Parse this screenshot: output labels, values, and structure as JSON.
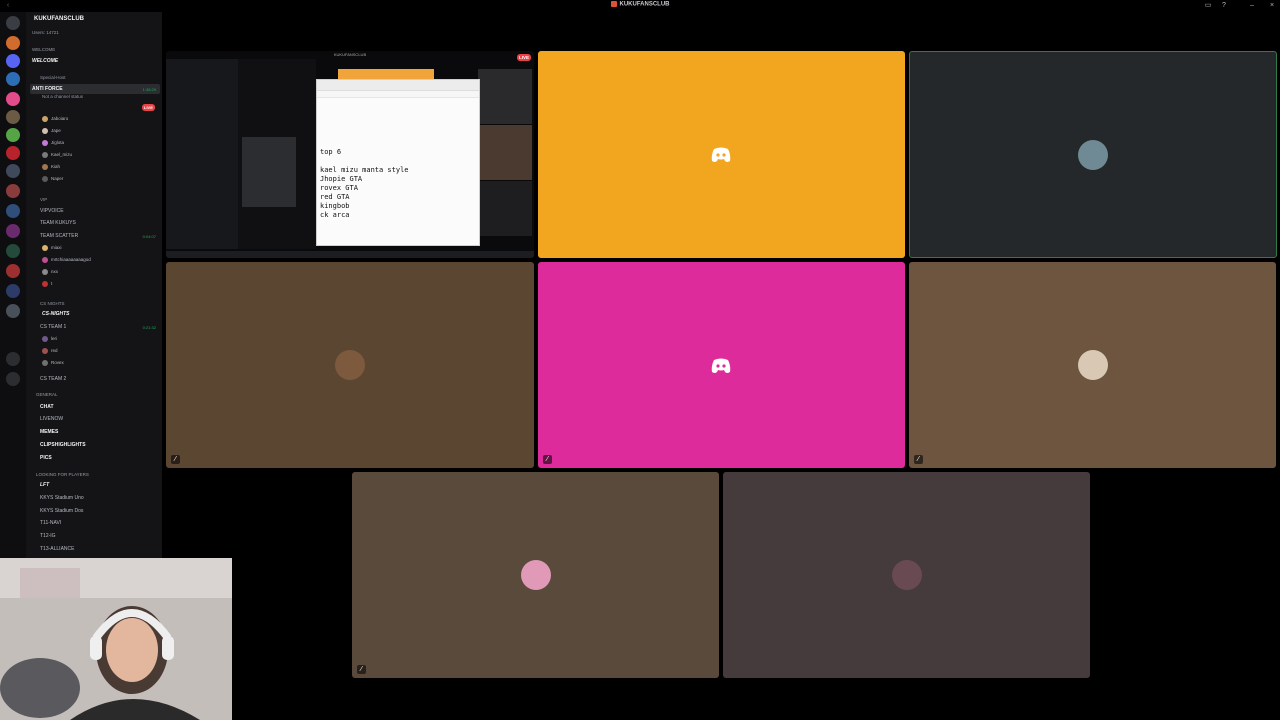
{
  "window": {
    "title": "KUKUFANSCLUB"
  },
  "server": {
    "name": "KUKUFANSCLUB",
    "users": "Users: 14721"
  },
  "channels": {
    "welcome_cat": "WELCOME",
    "welcome": "WELCOME",
    "special_cat": "Special-Host",
    "anti_force": "ANTI FORCE",
    "anti_force_status": "Not a channel status",
    "anti_force_timer": "1:38:29",
    "live": "LIVE",
    "voice_users_1": [
      "Jaboiaro",
      "Jape",
      "Jiglota",
      "Kael_mizu",
      "Kiah",
      "Naper"
    ],
    "vip_cat": "VIP",
    "vipvoice": "VIPVOICE",
    "team_kukuys": "TEAM KUKUYS",
    "team_scatter": "TEAM SCATTER",
    "team_scatter_timer": "0:04:07",
    "voice_users_2": [
      "miaxi",
      "mrtchiaaaaaaaagod",
      "nxx",
      "t"
    ],
    "cs_cat": "CS NIGHTS",
    "cs_nights": "CS-NIGHTS",
    "cs_team1": "CS TEAM 1",
    "cs_team1_timer": "0:21:32",
    "voice_users_3": [
      "leri",
      "red",
      "Rovex"
    ],
    "cs_team2": "CS TEAM 2",
    "general_cat": "GENERAL",
    "chat": "CHAT",
    "livenow": "LIVENOW",
    "memes": "MEMES",
    "clips": "CLIPSHIGHLIGHTS",
    "pics": "PICS",
    "lfp_cat": "LOOKING FOR PLAYERS",
    "lft": "LFT",
    "stadium_uno": "KKYS Stadium Uno",
    "stadium_dos": "KKYS Stadium Dos",
    "t11": "T11-NAVI",
    "t12": "T12-IG",
    "t13": "T13-ALLIANCE"
  },
  "stream": {
    "title": "KUKUFANSCLUB",
    "live": "LIVE",
    "notepad_lines": [
      "top 6",
      "",
      "kael mizu manta style",
      "Jhopie GTA",
      "rovex GTA",
      "red GTA",
      "kingbob",
      "ck arca"
    ]
  },
  "colors": {
    "tile_orange": "#f2a51f",
    "tile_dark": "#24282a",
    "tile_brown1": "#5b4632",
    "tile_pink": "#de2b9b",
    "tile_brown2": "#6e5540",
    "tile_brown3": "#5a4a3c",
    "tile_mauve": "#453a3c"
  }
}
